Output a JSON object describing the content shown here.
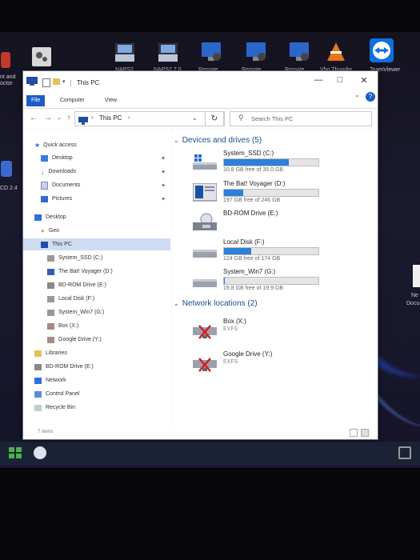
{
  "desktop": {
    "top_icons": [
      {
        "name": "settings-app-icon",
        "label": ""
      },
      {
        "name": "scanner-icon",
        "label": "NAPS2"
      },
      {
        "name": "scanner-icon-2",
        "label": "NAPS2 7.0"
      },
      {
        "name": "remote-desktop-icon",
        "label": "Remote"
      },
      {
        "name": "remote-desktop-icon-2",
        "label": "Remote"
      },
      {
        "name": "remote-desktop-icon-3",
        "label": "Remote"
      },
      {
        "name": "vlc-icon",
        "label": "Vbo Thunder"
      },
      {
        "name": "teamviewer-icon",
        "label": "TeamViewer"
      }
    ],
    "left_labels": {
      "top": "nt and",
      "top2": "octor",
      "mid": "CD 2.4"
    },
    "right_label": {
      "line1": "Ne",
      "line2": "Docu"
    }
  },
  "window": {
    "title": "This PC",
    "ribbon_tabs": [
      "File",
      "Computer",
      "View"
    ],
    "address": "This PC",
    "search_placeholder": "Search This PC"
  },
  "nav": {
    "quick_access": "Quick access",
    "items": [
      {
        "label": "Desktop",
        "pinned": true
      },
      {
        "label": "Downloads",
        "pinned": true
      },
      {
        "label": "Documents",
        "pinned": true
      },
      {
        "label": "Pictures",
        "pinned": true
      }
    ],
    "desktop": "Desktop",
    "geo": "Geo",
    "this_pc": "This PC",
    "drives": [
      "System_SSD (C:)",
      "The Bat! Voyager (D:)",
      "BD-ROM Drive (E:)",
      "Local Disk (F:)",
      "System_Win7 (G:)",
      "Box (X:)",
      "Google Drive (Y:)"
    ],
    "libraries": "Libraries",
    "bdrom": "BD-ROM Drive (E:)",
    "network": "Network",
    "control_panel": "Control Panel",
    "recycle_bin": "Recycle Bin"
  },
  "content": {
    "devices_header": "Devices and drives (5)",
    "devices": [
      {
        "name": "System_SSD (C:)",
        "free": "10.8 GB free of 35.0 GB",
        "used_fraction": 0.69
      },
      {
        "name": "The Bat! Voyager (D:)",
        "free": "197 GB free of 246 GB",
        "used_fraction": 0.2
      },
      {
        "name": "BD-ROM Drive (E:)"
      },
      {
        "name": "Local Disk (F:)",
        "free": "124 GB free of 174 GB",
        "used_fraction": 0.29
      },
      {
        "name": "System_Win7 (G:)",
        "free": "19.8 GB free of 19.9 GB",
        "used_fraction": 0.01
      }
    ],
    "network_header": "Network locations (2)",
    "network": [
      {
        "name": "Box (X:)",
        "fs": "EXFS"
      },
      {
        "name": "Google Drive (Y:)",
        "fs": "EXFS"
      }
    ]
  },
  "status": {
    "items": "7 items"
  },
  "colors": {
    "accent": "#1d5cc7",
    "bar": "#2c80d8",
    "selected": "#cfdcf2",
    "header": "#1a4d8f"
  }
}
